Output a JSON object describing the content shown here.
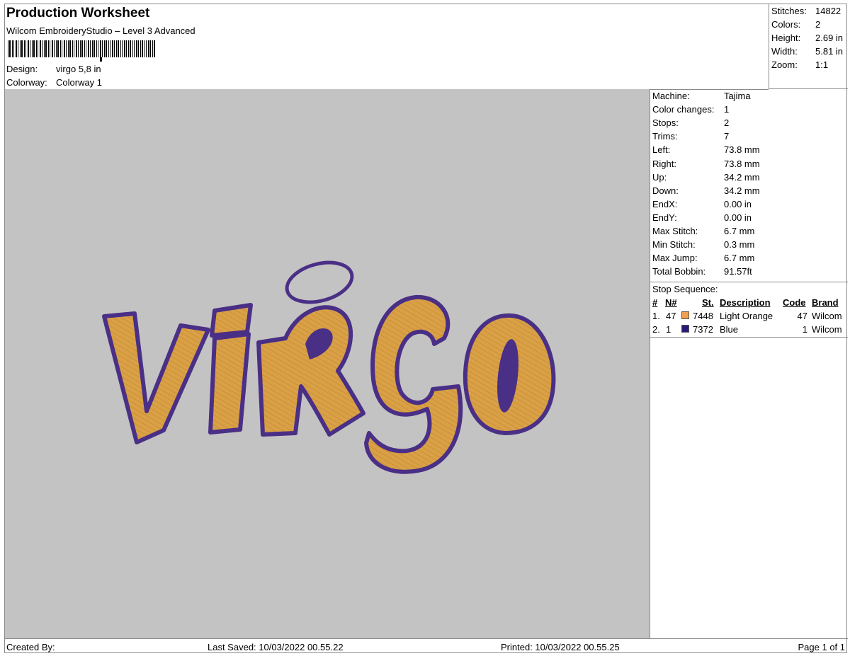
{
  "header": {
    "title": "Production Worksheet",
    "software": "Wilcom EmbroideryStudio – Level 3 Advanced",
    "design_label": "Design:",
    "design_value": "virgo 5,8 in",
    "colorway_label": "Colorway:",
    "colorway_value": "Colorway 1"
  },
  "summary": {
    "stitches_label": "Stitches:",
    "stitches": "14822",
    "colors_label": "Colors:",
    "colors": "2",
    "height_label": "Height:",
    "height": "2.69 in",
    "width_label": "Width:",
    "width": "5.81 in",
    "zoom_label": "Zoom:",
    "zoom": "1:1"
  },
  "design_preview": {
    "fill_color": "#d9a046",
    "outline_color": "#4a2f86",
    "background": "#c3c3c3"
  },
  "machine_info": [
    {
      "label": "Machine:",
      "value": "Tajima"
    },
    {
      "label": "Color changes:",
      "value": "1"
    },
    {
      "label": "Stops:",
      "value": "2"
    },
    {
      "label": "Trims:",
      "value": "7"
    },
    {
      "label": "Left:",
      "value": "73.8 mm"
    },
    {
      "label": "Right:",
      "value": "73.8 mm"
    },
    {
      "label": "Up:",
      "value": "34.2 mm"
    },
    {
      "label": "Down:",
      "value": "34.2 mm"
    },
    {
      "label": "EndX:",
      "value": "0.00 in"
    },
    {
      "label": "EndY:",
      "value": "0.00 in"
    },
    {
      "label": "Max Stitch:",
      "value": "6.7 mm"
    },
    {
      "label": "Min Stitch:",
      "value": "0.3 mm"
    },
    {
      "label": "Max Jump:",
      "value": "6.7 mm"
    },
    {
      "label": "Total Bobbin:",
      "value": "91.57ft"
    }
  ],
  "stop_sequence": {
    "title": "Stop Sequence:",
    "columns": [
      "#",
      "N#",
      "St.",
      "Description",
      "Code",
      "Brand"
    ],
    "rows": [
      {
        "num": "1.",
        "n": "47",
        "color": "#f0a050",
        "st": "7448",
        "description": "Light Orange",
        "code": "47",
        "brand": "Wilcom"
      },
      {
        "num": "2.",
        "n": "1",
        "color": "#2a1a78",
        "st": "7372",
        "description": "Blue",
        "code": "1",
        "brand": "Wilcom"
      }
    ]
  },
  "footer": {
    "created_by": "Created By:",
    "last_saved": "Last Saved: 10/03/2022 00.55.22",
    "printed": "Printed: 10/03/2022 00.55.25",
    "page": "Page 1 of 1"
  }
}
